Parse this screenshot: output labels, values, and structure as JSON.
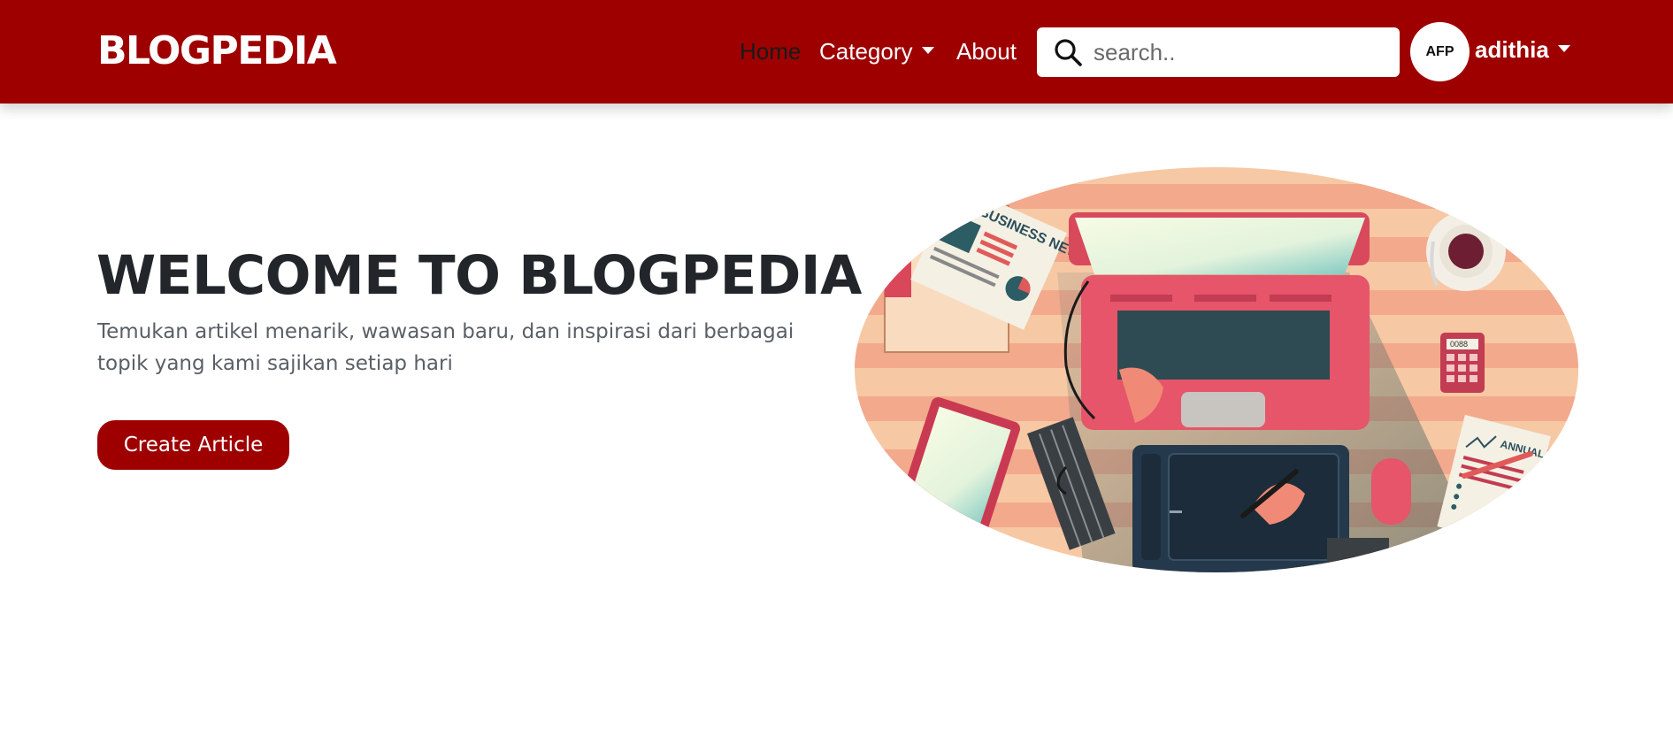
{
  "navbar": {
    "brand": "BLOGPEDIA",
    "links": {
      "home": "Home",
      "category": "Category",
      "about": "About"
    },
    "search": {
      "placeholder": "search..",
      "value": ""
    },
    "user": {
      "initials": "AFP",
      "name": "adithia"
    }
  },
  "hero": {
    "title": "WELCOME TO BLOGPEDIA",
    "description": "Temukan artikel menarik, wawasan baru, dan inspirasi dari berbagai topik yang kami sajikan setiap hari",
    "button": "Create Article",
    "illustration": {
      "newspaper_headline": "BUSINESS NEWS",
      "report_label": "ANNUAL REPORT",
      "calculator_display": "0088"
    }
  },
  "colors": {
    "primary": "#9e0000",
    "text_dark": "#22262b",
    "text_muted": "#5a5f66"
  }
}
